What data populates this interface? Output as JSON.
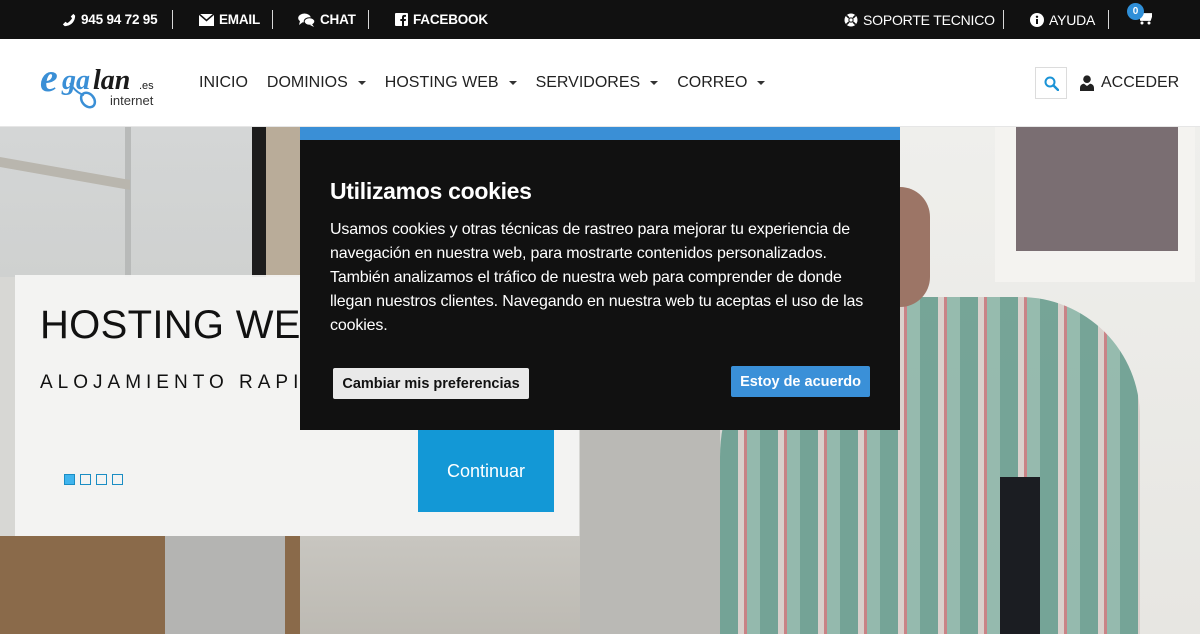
{
  "topbar": {
    "phone": "945 94 72 95",
    "email": "EMAIL",
    "chat": "CHAT",
    "facebook": "FACEBOOK",
    "support": "SOPORTE TECNICO",
    "help": "AYUDA",
    "cart_count": "0"
  },
  "header": {
    "logo_main": "egalan",
    "logo_tld": ".es",
    "logo_sub": "internet",
    "nav": [
      {
        "label": "INICIO",
        "dropdown": false
      },
      {
        "label": "DOMINIOS",
        "dropdown": true
      },
      {
        "label": "HOSTING WEB",
        "dropdown": true
      },
      {
        "label": "SERVIDORES",
        "dropdown": true
      },
      {
        "label": "CORREO",
        "dropdown": true
      }
    ],
    "login": "ACCEDER"
  },
  "hero": {
    "title": "HOSTING WEB",
    "subtitle": "ALOJAMIENTO RAPIDO",
    "continue": "Continuar",
    "slides": 4,
    "active_slide": 1
  },
  "cookie": {
    "title": "Utilizamos cookies",
    "text": "Usamos cookies y otras técnicas de rastreo para mejorar tu experiencia de navegación en nuestra web, para mostrarte contenidos personalizados. También analizamos el tráfico de nuestra web para comprender de donde llegan nuestros clientes. Navegando en nuestra web tu aceptas el uso de las cookies.",
    "prefs_button": "Cambiar mis preferencias",
    "accept_button": "Estoy de acuerdo"
  },
  "colors": {
    "topbar_bg": "#111111",
    "accent_blue": "#1398d6",
    "cookie_accent": "#3a8fd6",
    "cookie_bg": "#111111",
    "logo_blue": "#3a8fd6"
  }
}
